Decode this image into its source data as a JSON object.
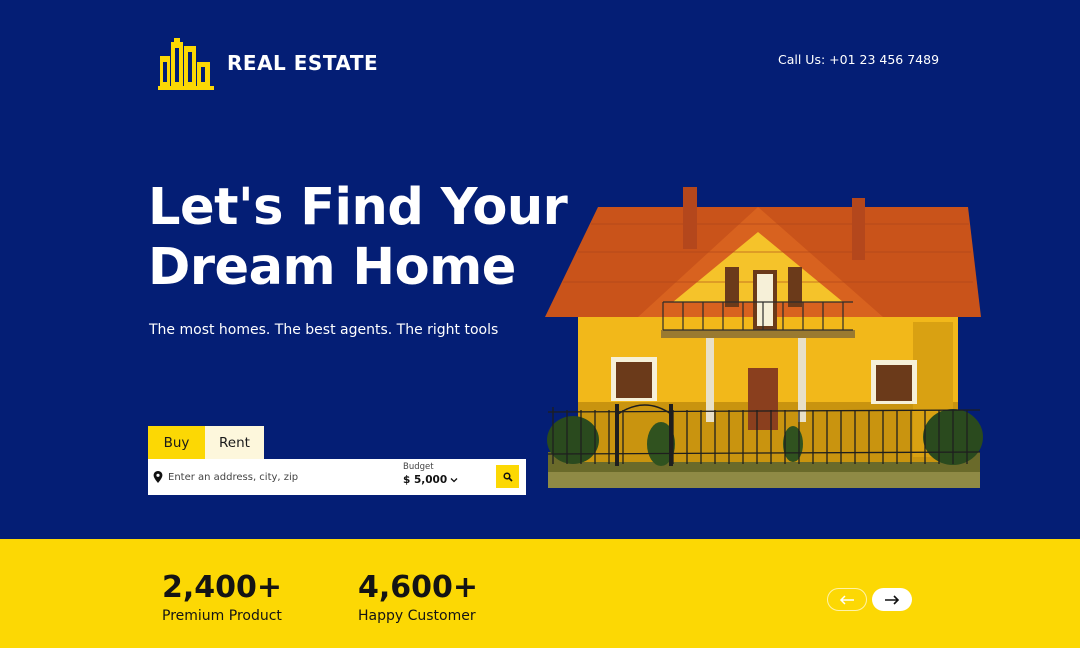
{
  "brand": {
    "name": "REAL ESTATE",
    "logo_icon": "buildings-icon",
    "accent_color": "#fcd804",
    "background_color": "#041e75"
  },
  "header": {
    "phone_label": "Call Us: +01 23 456 7489"
  },
  "hero": {
    "headline_line1": "Let's Find Your",
    "headline_line2": "Dream Home",
    "tagline": "The most homes. The best agents. The right tools",
    "image": "yellow-house-photo"
  },
  "search": {
    "tabs": [
      {
        "label": "Buy",
        "active": true
      },
      {
        "label": "Rent",
        "active": false
      }
    ],
    "address_placeholder": "Enter an address, city, zip",
    "budget_label": "Budget",
    "budget_value": "$ 5,000",
    "icons": {
      "location": "map-pin-icon",
      "search": "search-icon",
      "dropdown": "chevron-down-icon"
    }
  },
  "stats": [
    {
      "value": "2,400+",
      "label": "Premium Product"
    },
    {
      "value": "4,600+",
      "label": "Happy Customer"
    }
  ],
  "carousel": {
    "prev_icon": "arrow-left-icon",
    "next_icon": "arrow-right-icon"
  }
}
